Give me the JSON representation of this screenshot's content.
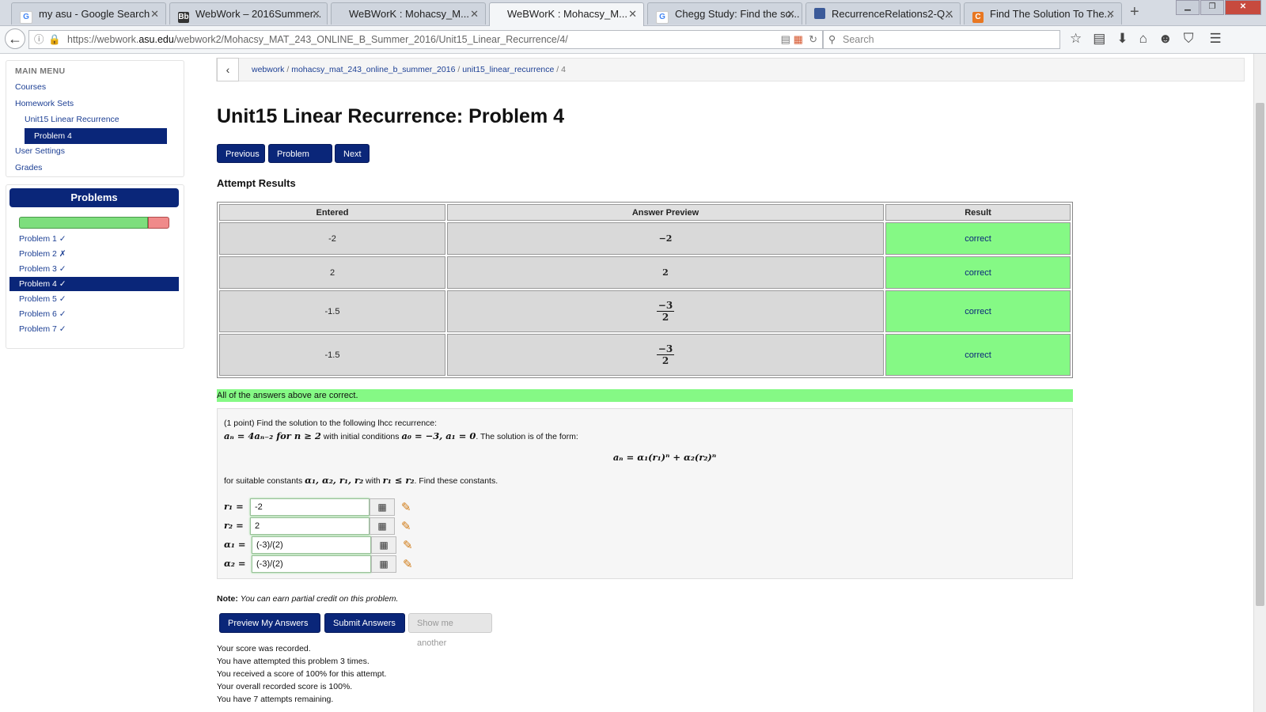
{
  "browser": {
    "tabs": [
      {
        "label": "my asu - Google Search",
        "icon": "google-icon",
        "active": false
      },
      {
        "label": "WebWork – 2016Summer...",
        "icon": "bb-icon",
        "active": false
      },
      {
        "label": "WeBWorK : Mohacsy_M...",
        "icon": "",
        "active": false
      },
      {
        "label": "WeBWorK : Mohacsy_M...",
        "icon": "",
        "active": true
      },
      {
        "label": "Chegg Study: Find the so...",
        "icon": "google-icon",
        "active": false
      },
      {
        "label": "RecurrenceRelations2-Q...",
        "icon": "doc-icon",
        "active": false
      },
      {
        "label": "Find The Solution To The...",
        "icon": "chegg-icon",
        "active": false
      }
    ],
    "url_prefix": "https://webwork.",
    "url_domain": "asu.edu",
    "url_path": "/webwork2/Mohacsy_MAT_243_ONLINE_B_Summer_2016/Unit15_Linear_Recurrence/4/",
    "search_placeholder": "Search"
  },
  "sidebar": {
    "menu_title": "MAIN MENU",
    "links": {
      "courses": "Courses",
      "homework_sets": "Homework Sets",
      "unit": "Unit15 Linear Recurrence",
      "problem": "Problem 4",
      "user_settings": "User Settings",
      "grades": "Grades"
    },
    "problems_title": "Problems",
    "progress_correct_fraction": 0.857,
    "problems": [
      {
        "label": "Problem 1 ✓",
        "active": false
      },
      {
        "label": "Problem 2 ✗",
        "active": false
      },
      {
        "label": "Problem 3 ✓",
        "active": false
      },
      {
        "label": "Problem 4 ✓",
        "active": true
      },
      {
        "label": "Problem 5 ✓",
        "active": false
      },
      {
        "label": "Problem 6 ✓",
        "active": false
      },
      {
        "label": "Problem 7 ✓",
        "active": false
      }
    ]
  },
  "breadcrumb": {
    "c1": "webwork",
    "c2": "mohacsy_mat_243_online_b_summer_2016",
    "c3": "unit15_linear_recurrence",
    "c4": "4",
    "sep": "/"
  },
  "page_title": "Unit15 Linear Recurrence: Problem 4",
  "nav_buttons": {
    "previous": "Previous",
    "problem_list": "Problem List",
    "next": "Next"
  },
  "attempt": {
    "heading": "Attempt Results",
    "headers": {
      "entered": "Entered",
      "preview": "Answer Preview",
      "result": "Result"
    },
    "rows": [
      {
        "entered": "-2",
        "preview": "−2",
        "result": "correct"
      },
      {
        "entered": "2",
        "preview": "2",
        "result": "correct"
      },
      {
        "entered": "-1.5",
        "preview_num": "−3",
        "preview_den": "2",
        "result": "correct"
      },
      {
        "entered": "-1.5",
        "preview_num": "−3",
        "preview_den": "2",
        "result": "correct"
      }
    ],
    "summary": "All of the answers above are correct."
  },
  "problem": {
    "points": "(1 point) Find the solution to the following lhcc recurrence:",
    "recurrence": "aₙ = 4aₙ₋₂ for n ≥ 2",
    "initial_text": " with initial conditions ",
    "initial": "a₀ = −3, a₁ = 0",
    "form_text": ". The solution is of the form:",
    "form": "aₙ = α₁(r₁)ⁿ + α₂(r₂)ⁿ",
    "constants_text": "for suitable constants ",
    "constants": "α₁, α₂, r₁, r₂",
    "with_text": " with ",
    "condition": "r₁ ≤ r₂",
    "find_text": ". Find these constants.",
    "answers": [
      {
        "label": "r₁ =",
        "value": "-2"
      },
      {
        "label": "r₂ =",
        "value": "2"
      },
      {
        "label": "α₁ =",
        "value": "(-3)/(2)"
      },
      {
        "label": "α₂ =",
        "value": "(-3)/(2)"
      }
    ]
  },
  "note": {
    "label": "Note:",
    "text": "You can earn partial credit on this problem."
  },
  "actions": {
    "preview": "Preview My Answers",
    "submit": "Submit Answers",
    "another": "Show me another"
  },
  "score_lines": [
    "Your score was recorded.",
    "You have attempted this problem 3 times.",
    "You received a score of 100% for this attempt.",
    "Your overall recorded score is 100%.",
    "You have 7 attempts remaining."
  ],
  "colors": {
    "nav_blue": "#0a2679",
    "correct_green": "#85f985",
    "link_blue": "#1c3f94"
  }
}
